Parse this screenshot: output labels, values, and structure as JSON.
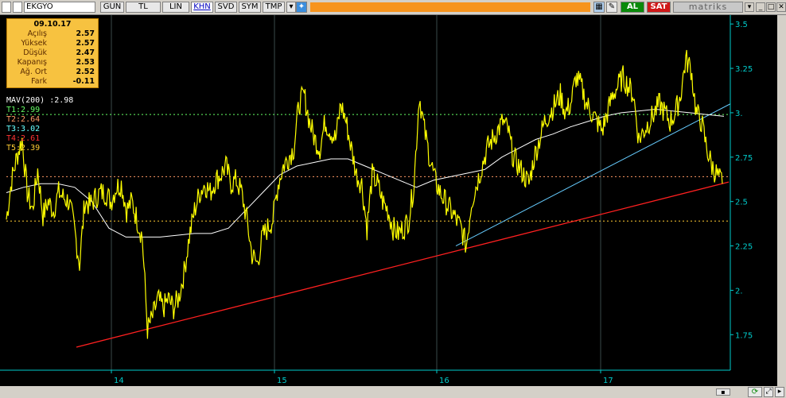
{
  "toolbar": {
    "symbol": "EKGYO",
    "buttons": [
      "GUN",
      "TL",
      "LIN",
      "KHN",
      "SVD",
      "SYM",
      "TMP"
    ],
    "selected": "KHN",
    "al_label": "AL",
    "sat_label": "SAT",
    "brand": "matriks"
  },
  "info": {
    "date": "09.10.17",
    "rows": [
      {
        "label": "Açılış",
        "value": "2.57"
      },
      {
        "label": "Yüksek",
        "value": "2.57"
      },
      {
        "label": "Düşük",
        "value": "2.47"
      },
      {
        "label": "Kapanış",
        "value": "2.53"
      },
      {
        "label": "Ağ. Ort",
        "value": "2.52"
      },
      {
        "label": "Fark",
        "value": "-0.11"
      }
    ]
  },
  "legend": {
    "mav_label": "MAV(200)",
    "mav_value": ":2.98",
    "t1": "T1:2.99",
    "t2": "T2:2.64",
    "t3": "T3:3.02",
    "t4": "T4:2.61",
    "t5": "T5:2.39"
  },
  "colors": {
    "price": "#ffff00",
    "mav": "#ffffff",
    "t1": "#66ff66",
    "t2": "#ff9966",
    "t3": "#66ffff",
    "t4": "#ff3333",
    "t5": "#ffcc33",
    "axis": "#00cccc",
    "trend_red": "#ff2020",
    "trend_cyan": "#66ccff"
  },
  "chart_data": {
    "type": "line",
    "ylim": [
      1.55,
      3.55
    ],
    "y_ticks": [
      "3.5",
      "3.25",
      "3.",
      "2.75",
      "2.5",
      "2.25",
      "2.",
      "1.75"
    ],
    "x_ticks": [
      "14",
      "15",
      "16",
      "17"
    ],
    "grid": "vertical grid only",
    "horizontal_levels": [
      {
        "name": "T1",
        "value": 2.99
      },
      {
        "name": "T2",
        "value": 2.64
      },
      {
        "name": "T3",
        "value": 3.02
      },
      {
        "name": "T4",
        "value": 2.61
      },
      {
        "name": "T5",
        "value": 2.39
      }
    ],
    "series": [
      {
        "name": "",
        "values": [
          2.4,
          2.62,
          2.75,
          2.85,
          2.55,
          2.45,
          2.68,
          2.42,
          2.5,
          2.45,
          2.55,
          2.52,
          2.5,
          2.35,
          2.15,
          2.5,
          2.48,
          2.52,
          2.55,
          2.55,
          2.5,
          2.58,
          2.6,
          2.45,
          2.5,
          2.4,
          2.3,
          1.78,
          1.85,
          1.95,
          1.9,
          1.95,
          1.9,
          1.96,
          2.1,
          2.3,
          2.45,
          2.55,
          2.6,
          2.55,
          2.62,
          2.65,
          2.7,
          2.6,
          2.62,
          2.55,
          2.4,
          2.2,
          2.15,
          2.3,
          2.35,
          2.4,
          2.6,
          2.7,
          2.75,
          2.8,
          3.05,
          3.1,
          2.95,
          2.85,
          2.8,
          2.95,
          2.9,
          2.85,
          3.05,
          2.95,
          2.8,
          2.65,
          2.6,
          2.35,
          2.65,
          2.6,
          2.5,
          2.45,
          2.35,
          2.32,
          2.35,
          2.4,
          2.6,
          3.1,
          2.9,
          2.75,
          2.62,
          2.55,
          2.5,
          2.45,
          2.4,
          2.35,
          2.25,
          2.5,
          2.6,
          2.7,
          2.8,
          2.85,
          2.9,
          2.95,
          2.9,
          2.75,
          2.7,
          2.65,
          2.6,
          2.75,
          2.85,
          2.95,
          3.0,
          3.05,
          3.1,
          3.0,
          3.05,
          3.2,
          3.15,
          3.05,
          3.0,
          2.95,
          2.9,
          3.0,
          3.1,
          3.15,
          3.2,
          3.15,
          3.1,
          2.85,
          2.9,
          2.95,
          3.0,
          3.05,
          3.0,
          2.95,
          3.0,
          3.1,
          3.3,
          3.25,
          3.0,
          2.95,
          2.8,
          2.7,
          2.65,
          2.6
        ]
      },
      {
        "name": "MAV(200)",
        "values": [
          2.55,
          2.58,
          2.6,
          2.6,
          2.58,
          2.5,
          2.35,
          2.3,
          2.3,
          2.3,
          2.31,
          2.32,
          2.32,
          2.35,
          2.45,
          2.55,
          2.65,
          2.7,
          2.72,
          2.74,
          2.74,
          2.7,
          2.66,
          2.62,
          2.58,
          2.62,
          2.64,
          2.66,
          2.68,
          2.75,
          2.8,
          2.85,
          2.88,
          2.92,
          2.95,
          2.98,
          3.0,
          3.01,
          3.02,
          3.01,
          3.0,
          2.99,
          2.98
        ]
      }
    ],
    "trendlines": [
      {
        "name": "T4 support",
        "from": 0.0,
        "to": 2.61,
        "y_start": 1.68,
        "y_end": 2.61
      },
      {
        "name": "cyan support",
        "y_start": 2.25,
        "y_end": 3.05
      }
    ]
  }
}
